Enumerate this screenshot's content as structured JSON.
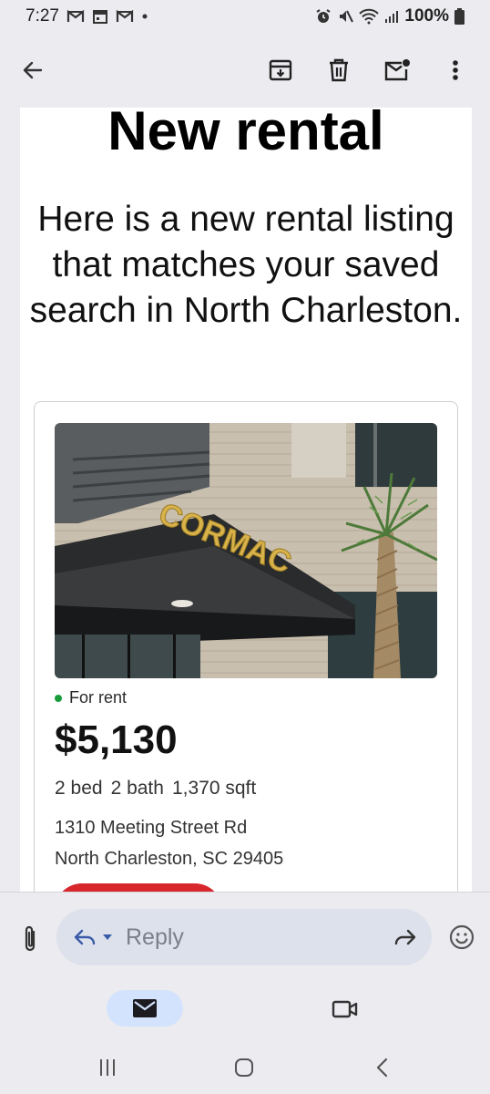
{
  "status_bar": {
    "time": "7:27",
    "battery": "100%",
    "notification_icons": [
      "gmail-icon",
      "calendar-icon",
      "gmail-icon",
      "dot"
    ],
    "system_icons": [
      "alarm-icon",
      "mute-icon",
      "wifi-icon",
      "signal-icon",
      "battery-icon"
    ]
  },
  "app_bar": {
    "back_icon": "arrow-left-icon",
    "action_icons": [
      "archive-icon",
      "delete-icon",
      "mark-unread-icon",
      "more-vertical-icon"
    ]
  },
  "email": {
    "headline": "New rental",
    "intro": "Here is a new rental listing that matches your saved search in North Charleston.",
    "listing": {
      "photo_sign_text": "CORMAC",
      "status": "For rent",
      "status_color": "#1a9b3c",
      "price": "$5,130",
      "beds": "2 bed",
      "baths": "2 bath",
      "sqft": "1,370 sqft",
      "address_line1": "1310 Meeting Street Rd",
      "address_line2": "North Charleston, SC 29405",
      "cta_color": "#d8262d"
    }
  },
  "reply_bar": {
    "placeholder": "Reply",
    "icons": [
      "attachment-icon",
      "reply-icon",
      "dropdown-icon",
      "forward-icon",
      "emoji-icon"
    ]
  },
  "bottom_nav": {
    "items": [
      "mail-icon",
      "video-icon"
    ],
    "active": "mail-icon",
    "active_color": "#d3e3fd"
  },
  "system_nav": [
    "recents-icon",
    "home-icon",
    "back-icon"
  ]
}
